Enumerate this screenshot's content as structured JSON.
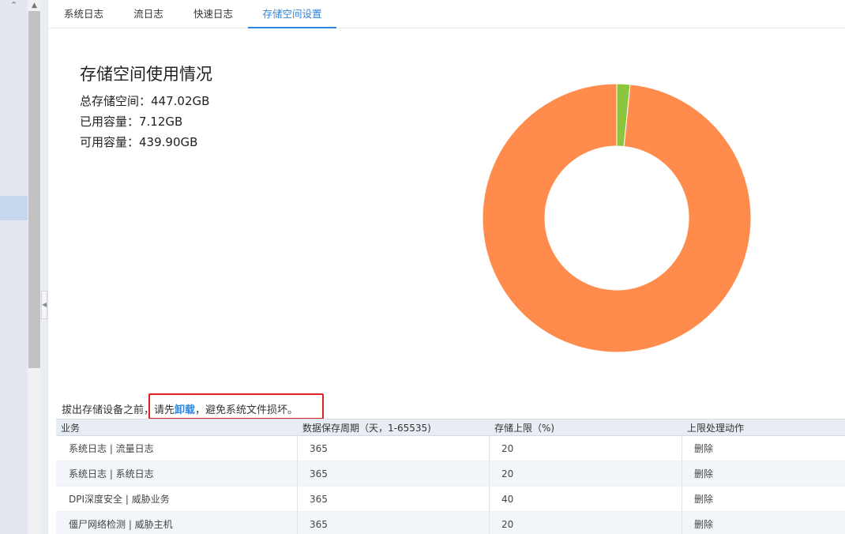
{
  "tabs": [
    {
      "label": "系统日志"
    },
    {
      "label": "流日志"
    },
    {
      "label": "快速日志"
    },
    {
      "label": "存储空间设置"
    }
  ],
  "usage": {
    "title": "存储空间使用情况",
    "total": "总存储空间：447.02GB",
    "used": "已用容量：7.12GB",
    "available": "可用容量：439.90GB"
  },
  "chart_data": {
    "type": "pie",
    "categories": [
      "已用容量",
      "可用容量"
    ],
    "values": [
      7.12,
      439.9
    ],
    "colors": [
      "#8cc63f",
      "#ff8c4d"
    ],
    "donut": true
  },
  "notice": {
    "before": "拔出存储设备之前，请先",
    "link": "卸载",
    "after": "，避免系统文件损坏。"
  },
  "table": {
    "headers": [
      "业务",
      "数据保存周期（天，1-65535)",
      "存储上限（%)",
      "上限处理动作"
    ],
    "rows": [
      {
        "service": "系统日志 | 流量日志",
        "days": "365",
        "limit": "20",
        "action": "删除"
      },
      {
        "service": "系统日志 | 系统日志",
        "days": "365",
        "limit": "20",
        "action": "删除"
      },
      {
        "service": "DPI深度安全 | 威胁业务",
        "days": "365",
        "limit": "40",
        "action": "删除"
      },
      {
        "service": "僵尸网络检测 | 威胁主机",
        "days": "365",
        "limit": "20",
        "action": "删除"
      }
    ]
  },
  "colors": {
    "accent": "#2e86de",
    "used": "#8cc63f",
    "free": "#ff8c4d",
    "highlight": "#e02020"
  }
}
